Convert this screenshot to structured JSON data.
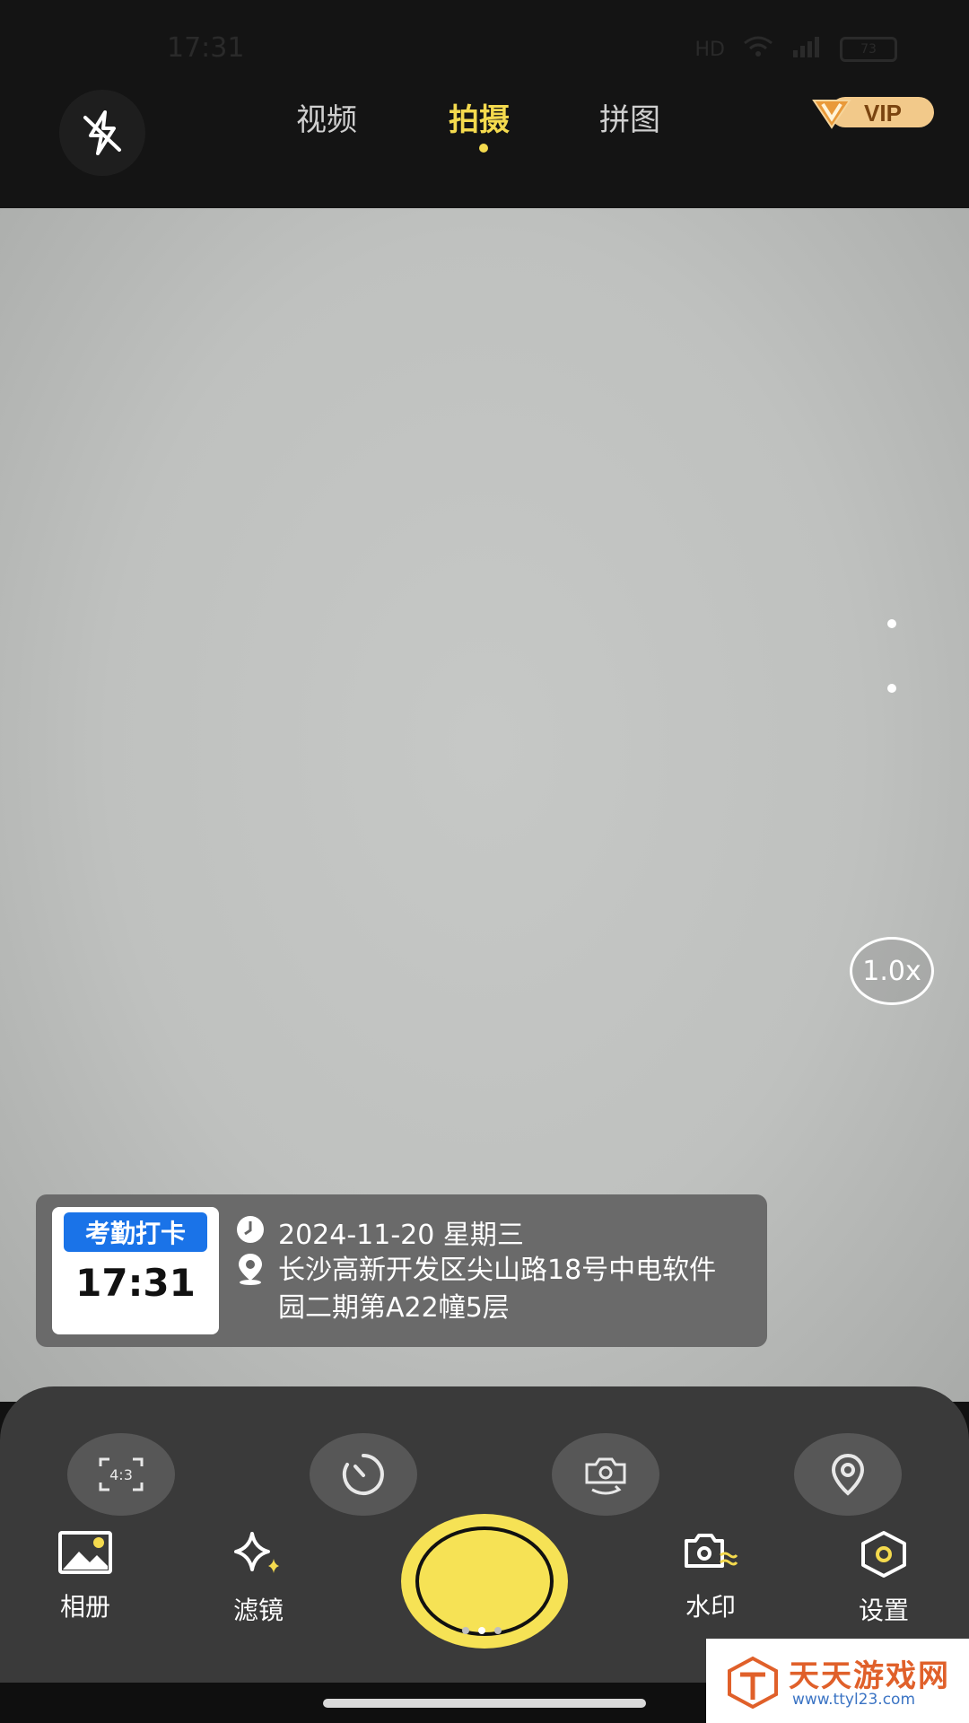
{
  "status_bar": {
    "time": "17:31",
    "network": "HD",
    "battery": "73"
  },
  "top": {
    "tabs": [
      {
        "label": "视频",
        "active": false
      },
      {
        "label": "拍摄",
        "active": true
      },
      {
        "label": "拼图",
        "active": false
      }
    ],
    "vip_label": "VIP",
    "flash_icon": "flash-off-icon"
  },
  "viewfinder": {
    "zoom": "1.0x"
  },
  "watermark": {
    "badge_label": "考勤打卡",
    "badge_time": "17:31",
    "date": "2024-11-20 星期三",
    "address": "长沙高新开发区尖山路18号中电软件园二期第A22幢5层"
  },
  "tools": [
    {
      "icon": "aspect-ratio-icon",
      "text": "4:3"
    },
    {
      "icon": "timer-icon"
    },
    {
      "icon": "switch-camera-icon"
    },
    {
      "icon": "location-icon"
    }
  ],
  "bottom": {
    "album_label": "相册",
    "filter_label": "滤镜",
    "watermark_label": "水印",
    "settings_label": "设置"
  },
  "site_watermark": {
    "title": "天天游戏网",
    "url": "www.ttyl23.com"
  },
  "colors": {
    "accent": "#f4da4e",
    "badge_blue": "#1a73e8",
    "panel": "#3a3a3a"
  }
}
